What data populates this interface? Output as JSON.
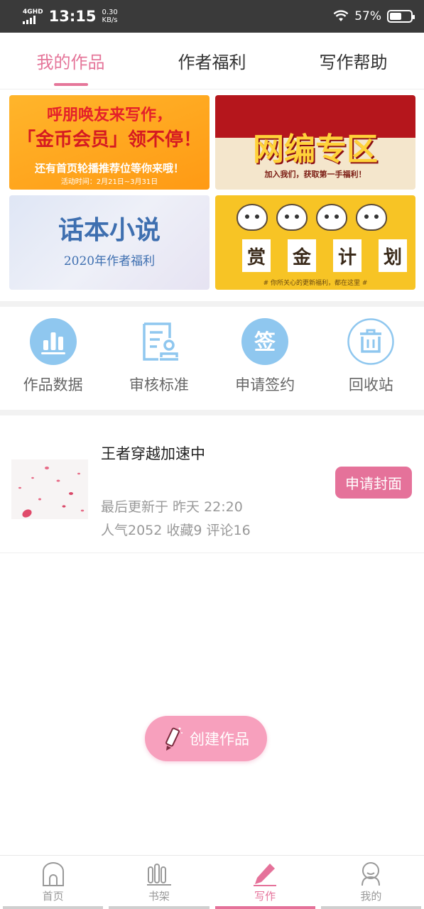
{
  "status_bar": {
    "network": "4GHD",
    "time": "13:15",
    "speed_value": "0.30",
    "speed_unit": "KB/s",
    "battery": "57%",
    "battery_level": 0.57
  },
  "tabs": [
    {
      "label": "我的作品",
      "active": true
    },
    {
      "label": "作者福利",
      "active": false
    },
    {
      "label": "写作帮助",
      "active": false
    }
  ],
  "banners": {
    "b1": {
      "line1": "呼朋唤友来写作，",
      "line2": "「金币会员」领不停！",
      "line3": "还有首页轮播推荐位等你来哦！",
      "line4": "活动时间：2月21日~3月31日"
    },
    "b2": {
      "line1": "网编专区",
      "line2": "加入我们，获取第一手福利！"
    },
    "b3": {
      "line1": "话本小说",
      "line2": "2020年作者福利"
    },
    "b4": {
      "chars": [
        "赏",
        "金",
        "计",
        "划"
      ],
      "line3": "# 你所关心的更新福利，都在这里 #"
    }
  },
  "tools": [
    {
      "label": "作品数据",
      "icon": "bar-chart-icon"
    },
    {
      "label": "审核标准",
      "icon": "review-doc-icon"
    },
    {
      "label": "申请签约",
      "icon": "sign-icon",
      "icon_char": "签"
    },
    {
      "label": "回收站",
      "icon": "trash-icon"
    }
  ],
  "work": {
    "title": "王者穿越加速中",
    "last_update": "最后更新于 昨天 22:20",
    "stats": "人气2052 收藏9 评论16",
    "cover_button": "申请封面"
  },
  "create_button": "创建作品",
  "bottom_nav": [
    {
      "label": "首页",
      "icon": "home-icon",
      "active": false
    },
    {
      "label": "书架",
      "icon": "bookshelf-icon",
      "active": false
    },
    {
      "label": "写作",
      "icon": "pencil-icon",
      "active": true
    },
    {
      "label": "我的",
      "icon": "profile-icon",
      "active": false
    }
  ],
  "colors": {
    "accent": "#e5769a",
    "icon_blue": "#8fc7ef"
  }
}
